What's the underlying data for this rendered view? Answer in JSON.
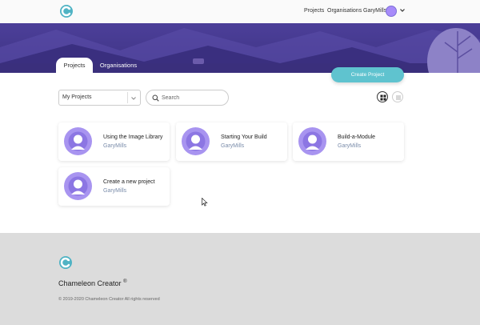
{
  "nav": {
    "links": [
      "Projects",
      "Organisations"
    ],
    "username": "GaryMills"
  },
  "tabs": [
    "Projects",
    "Organisations"
  ],
  "create_button": "Create Project",
  "filter": {
    "selected": "My Projects"
  },
  "search": {
    "placeholder": "Search"
  },
  "view_modes": [
    "grid-icon",
    "list-icon"
  ],
  "cards": [
    {
      "title": "Using the Image Library",
      "owner": "GaryMills"
    },
    {
      "title": "Starting Your Build",
      "owner": "GaryMills"
    },
    {
      "title": "Build-a-Module",
      "owner": "GaryMills"
    },
    {
      "title": "Create a new project",
      "owner": "GaryMills"
    }
  ],
  "footer": {
    "brand": "Chameleon Creator",
    "registered": "®",
    "copyright": "© 2019-2020 Chameleon Creator All rights reserved"
  },
  "colors": {
    "accent": "#5fc3cf",
    "banner": "#4c3f99",
    "avatar": "#a78bfa"
  }
}
